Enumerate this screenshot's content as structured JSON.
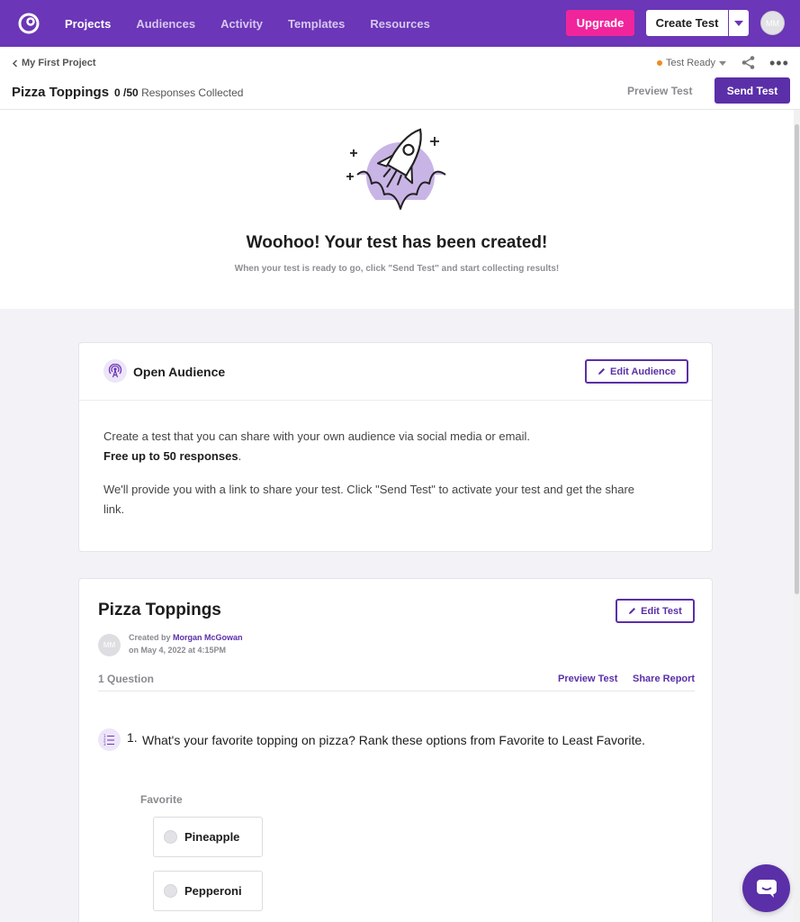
{
  "nav": {
    "items": [
      {
        "label": "Projects",
        "active": true
      },
      {
        "label": "Audiences",
        "active": false
      },
      {
        "label": "Activity",
        "active": false
      },
      {
        "label": "Templates",
        "active": false
      },
      {
        "label": "Resources",
        "active": false
      }
    ],
    "upgrade_label": "Upgrade",
    "create_label": "Create Test",
    "avatar_initials": "MM"
  },
  "subheader": {
    "breadcrumb": "My First Project",
    "title": "Pizza Toppings",
    "responses_current": "0",
    "responses_total": "/50",
    "responses_label": "Responses Collected",
    "status": "Test Ready",
    "preview_label": "Preview Test",
    "send_label": "Send Test"
  },
  "hero": {
    "title": "Woohoo! Your test has been created!",
    "subtitle": "When your test is ready to go, click \"Send Test\" and start collecting results!"
  },
  "audience": {
    "title": "Open Audience",
    "edit_label": "Edit Audience",
    "line1": "Create a test that you can share with your own audience via social media or email.",
    "line2": "Free up to 50 responses",
    "line2_suffix": ".",
    "line3": "We'll provide you with a link to share your test. Click \"Send Test\" to activate your test and get the share link."
  },
  "test": {
    "title": "Pizza Toppings",
    "edit_label": "Edit Test",
    "creator_avatar": "MM",
    "created_by_prefix": "Created by ",
    "creator_name": "Morgan McGowan",
    "created_on": "on May 4, 2022 at 4:15PM",
    "question_count": "1 Question",
    "preview_link": "Preview Test",
    "share_link": "Share Report",
    "question": {
      "number": "1.",
      "text": "What's your favorite topping on pizza? Rank these options from Favorite to Least Favorite.",
      "top_label": "Favorite",
      "options": [
        "Pineapple",
        "Pepperoni"
      ]
    }
  },
  "colors": {
    "brand": "#6b36b7",
    "primary": "#5b2fa8",
    "upgrade": "#f0259b",
    "status_dot": "#f08a24"
  }
}
